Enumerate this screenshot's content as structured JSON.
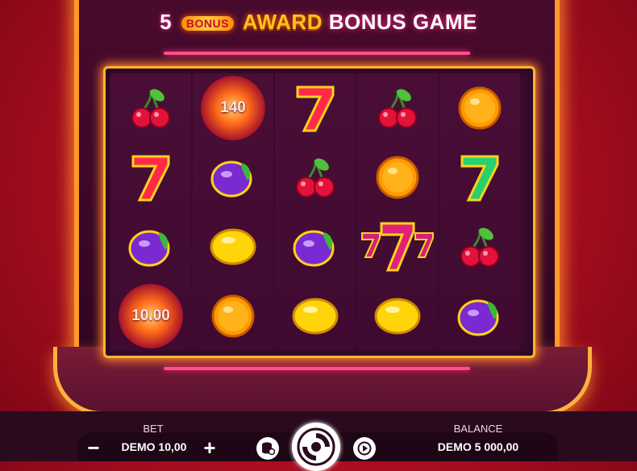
{
  "title": {
    "count": "5",
    "coin_text": "BONUS",
    "award": "AWARD",
    "rest": "BONUS GAME"
  },
  "reels": [
    [
      "cherry",
      "coin",
      "seven-red",
      "cherry",
      "orange"
    ],
    [
      "seven-red",
      "plum",
      "cherry",
      "orange",
      "seven-green"
    ],
    [
      "plum",
      "lemon",
      "plum",
      "triple-seven",
      "cherry"
    ],
    [
      "coin",
      "orange",
      "lemon",
      "lemon",
      "plum"
    ]
  ],
  "coin_values": {
    "r0c1": "140",
    "r3c0": "10.00"
  },
  "bet": {
    "label": "BET",
    "value": "DEMO 10,00",
    "minus": "−",
    "plus": "+"
  },
  "balance": {
    "label": "BALANCE",
    "value": "DEMO 5 000,00"
  },
  "colors": {
    "neon_frame": "#ffb33a",
    "neon_line": "#ff4f8b",
    "background": "#b01020"
  }
}
